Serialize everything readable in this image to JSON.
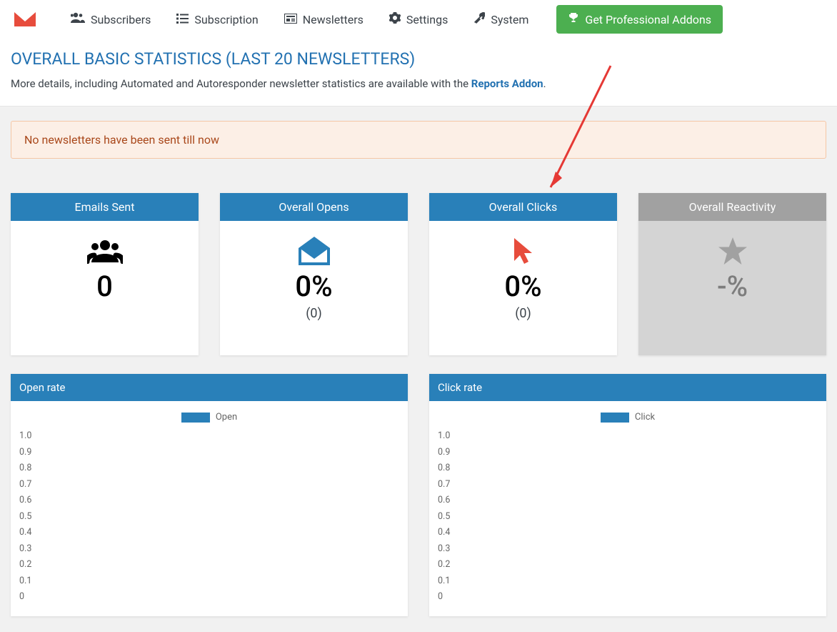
{
  "nav": {
    "subscribers": "Subscribers",
    "subscription": "Subscription",
    "newsletters": "Newsletters",
    "settings": "Settings",
    "system": "System",
    "pro_button": "Get Professional Addons"
  },
  "header": {
    "title": "OVERALL BASIC STATISTICS (LAST 20 NEWSLETTERS)",
    "subtitle_pre": "More details, including Automated and Autoresponder newsletter statistics are available with the ",
    "reports_link": "Reports Addon",
    "subtitle_post": "."
  },
  "notice": "No newsletters have been sent till now",
  "cards": {
    "emails_sent": {
      "title": "Emails Sent",
      "value": "0"
    },
    "overall_opens": {
      "title": "Overall Opens",
      "value": "0%",
      "sub": "(0)"
    },
    "overall_clicks": {
      "title": "Overall Clicks",
      "value": "0%",
      "sub": "(0)"
    },
    "overall_reactivity": {
      "title": "Overall Reactivity",
      "value": "-%"
    }
  },
  "charts": {
    "open": {
      "title": "Open rate",
      "legend": "Open"
    },
    "click": {
      "title": "Click rate",
      "legend": "Click"
    },
    "yticks": [
      "1.0",
      "0.9",
      "0.8",
      "0.7",
      "0.6",
      "0.5",
      "0.4",
      "0.3",
      "0.2",
      "0.1",
      "0"
    ]
  },
  "chart_data": [
    {
      "type": "line",
      "title": "Open rate",
      "legend": [
        "Open"
      ],
      "series": [
        {
          "name": "Open",
          "values": []
        }
      ],
      "xlabel": "",
      "ylabel": "",
      "ylim": [
        0,
        1
      ],
      "yticks": [
        0,
        0.1,
        0.2,
        0.3,
        0.4,
        0.5,
        0.6,
        0.7,
        0.8,
        0.9,
        1.0
      ]
    },
    {
      "type": "line",
      "title": "Click rate",
      "legend": [
        "Click"
      ],
      "series": [
        {
          "name": "Click",
          "values": []
        }
      ],
      "xlabel": "",
      "ylabel": "",
      "ylim": [
        0,
        1
      ],
      "yticks": [
        0,
        0.1,
        0.2,
        0.3,
        0.4,
        0.5,
        0.6,
        0.7,
        0.8,
        0.9,
        1.0
      ]
    }
  ]
}
